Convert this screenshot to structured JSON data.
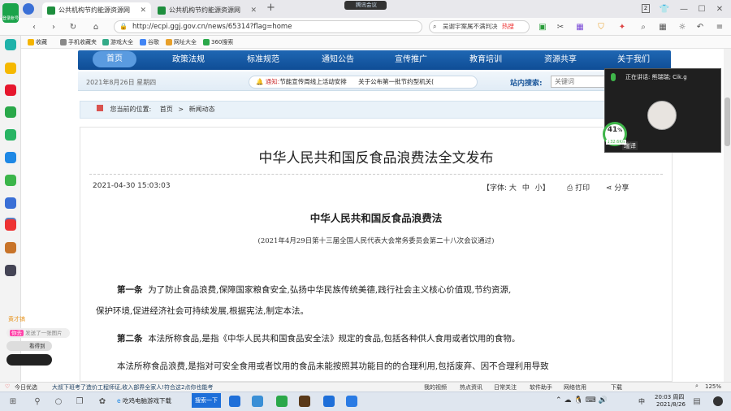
{
  "tabs": [
    {
      "label": "公共机构节约能源资源网",
      "active": true
    },
    {
      "label": "公共机构节约能源资源网",
      "active": false
    }
  ],
  "tencent_meeting": "腾讯会议",
  "window_num": "2",
  "address": {
    "url": "http://ecpi.ggj.gov.cn/news/65314?flag=home",
    "search_text": "吴谢宇案属不满判决",
    "hot": "热搜"
  },
  "bookmarks": [
    "收藏",
    "手机收藏夹",
    "游戏大全",
    "谷歌",
    "网址大全",
    "360搜索"
  ],
  "side_badge": "登录账号",
  "nav": [
    "首页",
    "政策法规",
    "标准规范",
    "通知公告",
    "宣传推广",
    "教育培训",
    "资源共享",
    "关于我们"
  ],
  "info": {
    "date": "2021年8月26日 星期四",
    "notice_label": "通知:",
    "notice_text": "节能宣传周线上活动安排",
    "notice_text2": "关于公布第一批节约型机关(",
    "search_label": "站内搜索:",
    "search_placeholder": "关键词"
  },
  "breadcrumb": {
    "label": "您当前的位置:",
    "home": "首页",
    "sep": ">",
    "current": "新闻动态"
  },
  "article": {
    "title": "中华人民共和国反食品浪费法全文发布",
    "datetime": "2021-04-30 15:03:03",
    "font_label": "【字体:",
    "font_sizes": [
      "大",
      "中",
      "小"
    ],
    "font_end": "】",
    "print": "打印",
    "share": "分享",
    "law_title": "中华人民共和国反食品浪费法",
    "subtitle": "(2021年4月29日第十三届全国人民代表大会常务委员会第二十八次会议通过)",
    "p1_head": "第一条",
    "p1": "为了防止食品浪费,保障国家粮食安全,弘扬中华民族传统美德,践行社会主义核心价值观,节约资源,",
    "p1b": "保护环境,促进经济社会可持续发展,根据宪法,制定本法。",
    "p2_head": "第二条",
    "p2": "本法所称食品,是指《中华人民共和国食品安全法》规定的食品,包括各种供人食用或者饮用的食物。",
    "p3": "本法所称食品浪费,是指对可安全食用或者饮用的食品未能按照其功能目的的合理利用,包括废弃、因不合理利用导致"
  },
  "meeting": {
    "speaking": "正在讲话: 熊瑞瑞; Cik.g",
    "name_tag": "瑞译",
    "percent": "41",
    "percent_unit": "%",
    "speed": "↓32.6K/s"
  },
  "float_panel": {
    "title": "黄才镐",
    "msg_name": "你去",
    "msg": "发送了一张图片",
    "chip": "看得到"
  },
  "status": {
    "left": "今日优选",
    "news": "大叔下班考了造价工程师证,收入部界全家人!符合这2点你也能考",
    "items": [
      "我的视频",
      "热点资讯",
      "日常关注",
      "软件助手",
      "网络信用",
      "下载"
    ],
    "zoom": "125%"
  },
  "taskbar": {
    "app_label": "吃鸡电脑游戏下载",
    "btn": "搜索一下",
    "time": "20:03 周四",
    "date": "2021/8/26",
    "ime": "中"
  }
}
